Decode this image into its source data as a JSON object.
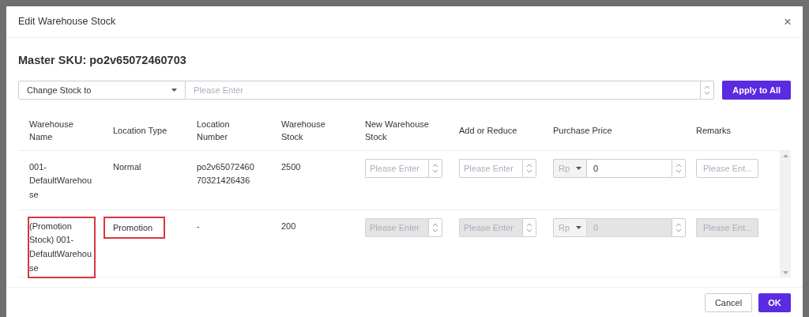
{
  "dialog": {
    "title": "Edit Warehouse Stock",
    "close": "×"
  },
  "master_sku": "Master SKU: po2v65072460703",
  "toolbar": {
    "mode": "Change Stock to",
    "placeholder": "Please Enter",
    "apply": "Apply to All"
  },
  "table": {
    "columns": [
      "Warehouse Name",
      "Location Type",
      "Location Number",
      "Warehouse Stock",
      "New Warehouse Stock",
      "Add or Reduce",
      "Purchase Price",
      "Remarks"
    ],
    "rows": [
      {
        "warehouse_name": "001-DefaultWarehouse",
        "location_type": "Normal",
        "location_number": "po2v6507246070321426436",
        "warehouse_stock": "2500",
        "new_stock_placeholder": "Please Enter",
        "add_reduce_placeholder": "Please Enter",
        "currency": "Rp",
        "price": "0",
        "remarks_placeholder": "Please Ent...",
        "disabled": false,
        "highlighted": false
      },
      {
        "warehouse_name": "(Promotion Stock) 001-DefaultWarehouse",
        "location_type": "Promotion",
        "location_number": "-",
        "warehouse_stock": "200",
        "new_stock_placeholder": "Please Enter",
        "add_reduce_placeholder": "Please Enter",
        "currency": "Rp",
        "price": "0",
        "remarks_placeholder": "Please Ent...",
        "disabled": true,
        "highlighted": true
      }
    ]
  },
  "footer": {
    "buttons": [
      "Cancel",
      "OK"
    ]
  }
}
